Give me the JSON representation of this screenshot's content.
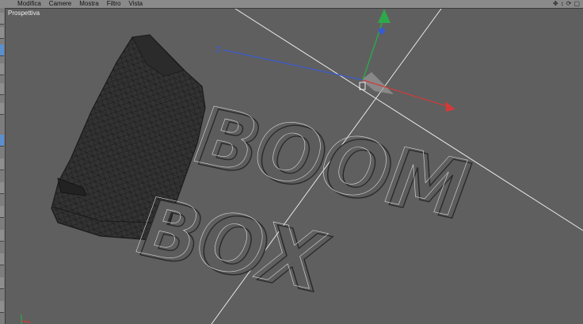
{
  "menu": {
    "items": [
      "Modifica",
      "Camere",
      "Mostra",
      "Filtro",
      "Vista"
    ]
  },
  "viewport": {
    "label": "Prospettiva",
    "axis_labels": {
      "x": "X",
      "y": "Y",
      "z": "Z"
    }
  },
  "scene": {
    "text_line_1": "BOOM",
    "text_line_2": "BOX"
  },
  "nav_icons": [
    "move-view-icon",
    "zoom-view-icon",
    "rotate-view-icon",
    "toggle-view-icon"
  ],
  "colors": {
    "x_axis": "#d23a3a",
    "y_axis": "#2ea84a",
    "z_axis": "#3a5ad0",
    "background": "#5f5f5f",
    "mesh": "#2a2a2a"
  }
}
